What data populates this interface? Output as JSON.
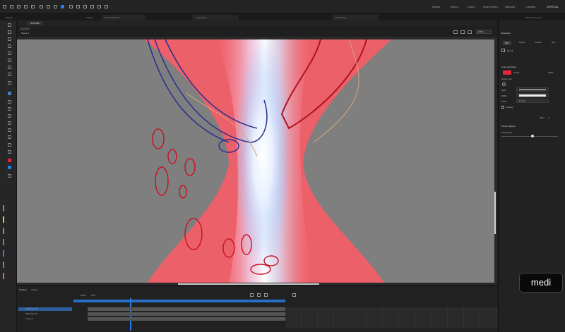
{
  "app": {
    "accent": "#2680eb",
    "stroke_color": "#e8263a"
  },
  "topbar": {
    "workspaces": [
      "Default",
      "Tweens",
      "Layers",
      "Small Screen",
      "Standard",
      "Libraries",
      "VERTICAL"
    ],
    "panel_labels": [
      "Shapes",
      "Scripts",
      "Effect Cardinals",
      "Composition",
      "Composition",
      "Effects & Presets"
    ]
  },
  "tabs": {
    "doc_tab": "Animate",
    "scene_label": "Scene 1"
  },
  "stage": {
    "zoom": "100%"
  },
  "properties": {
    "title": "Properties",
    "tabs": [
      "Tool",
      "Object",
      "Frame",
      "Doc"
    ],
    "tool_name": "Pencil",
    "section_color": "Color and Style",
    "stroke_label": "Stroke",
    "stroke_pct": "100%",
    "stroke_size_label": "Stroke size",
    "style_label": "Style",
    "width_label": "Width",
    "scale_label": "Scale",
    "scale_value": "Normal",
    "hinting_label": "Hinting",
    "miter_label": "Miter",
    "miter_value": "3",
    "section_pencil": "Pencil Options",
    "smoothing_label": "Smoothing"
  },
  "timeline": {
    "tabs": [
      "Timeline",
      "Output"
    ],
    "fps": "24.00",
    "fps_unit": "FPS",
    "layers": [
      "SKETCH_03",
      "SKETCH_02",
      "Layer_1"
    ]
  },
  "logo": {
    "text": "medi"
  }
}
